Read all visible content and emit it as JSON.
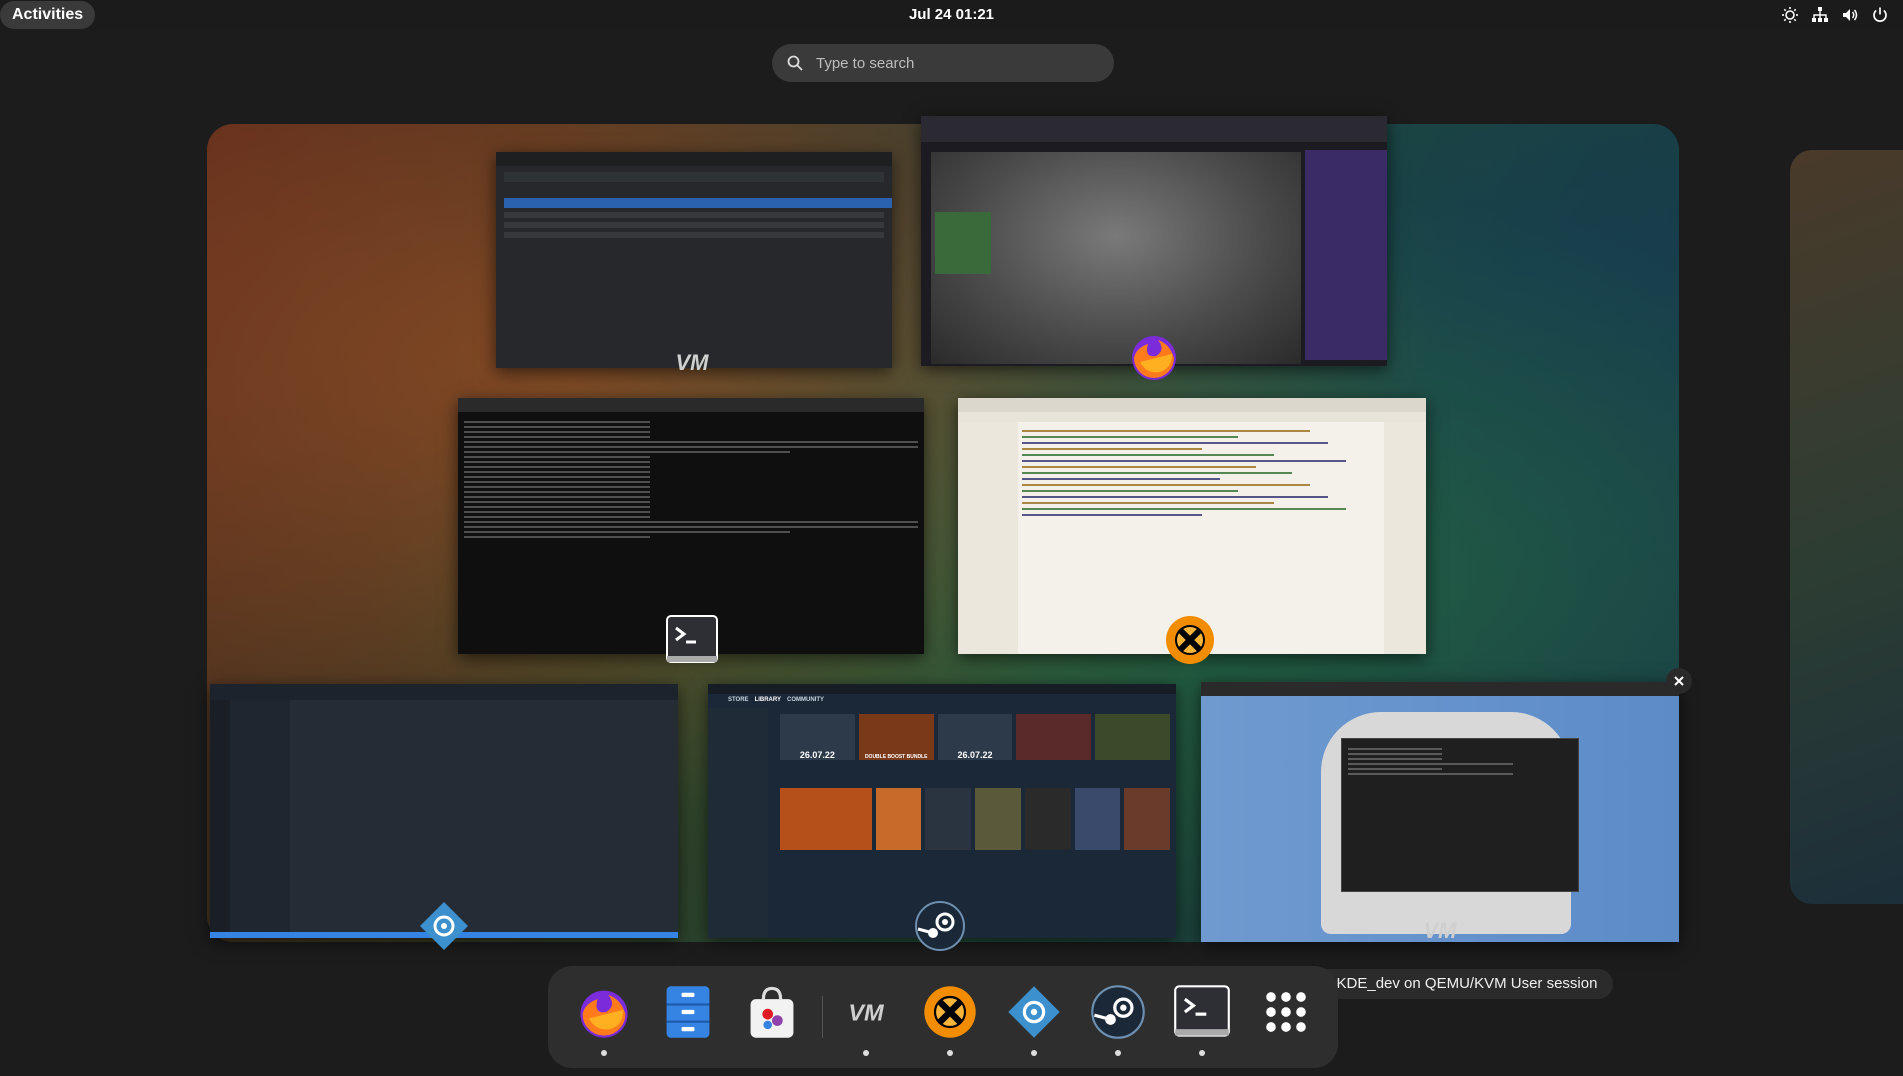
{
  "topbar": {
    "activities_label": "Activities",
    "clock": "Jul 24  01:21",
    "tray_icons": [
      "brightness-icon",
      "network-icon",
      "volume-icon",
      "power-icon"
    ]
  },
  "search": {
    "placeholder": "Type to search"
  },
  "windows": [
    {
      "id": "virt-manager-window",
      "app": "Virtual Machine Manager",
      "icon": "virt-manager-icon"
    },
    {
      "id": "firefox-window",
      "app": "Firefox",
      "icon": "firefox-icon"
    },
    {
      "id": "terminal-window",
      "app": "Terminal",
      "icon": "terminal-icon"
    },
    {
      "id": "editor-window",
      "app": "Text Editor",
      "icon": "editor-icon"
    },
    {
      "id": "kube-window",
      "app": "Kubernetes Desktop",
      "icon": "kube-icon"
    },
    {
      "id": "steam-window",
      "app": "Steam",
      "icon": "steam-icon",
      "nav": [
        "STORE",
        "LIBRARY",
        "COMMUNITY"
      ],
      "banner_dates": [
        "26.07.22",
        "26.07.22"
      ],
      "banner_text": "DOUBLE BOOST BUNDLE"
    },
    {
      "id": "vm-window",
      "app": "QEMU/KVM",
      "icon": "virt-manager-icon"
    }
  ],
  "dock": {
    "items": [
      {
        "name": "firefox",
        "running": true
      },
      {
        "name": "files",
        "running": false
      },
      {
        "name": "software",
        "running": false
      },
      {
        "name": "virt-manager",
        "running": true
      },
      {
        "name": "xfce-app",
        "running": true
      },
      {
        "name": "kube",
        "running": true
      },
      {
        "name": "steam",
        "running": true
      },
      {
        "name": "terminal",
        "running": true
      },
      {
        "name": "app-grid",
        "running": false
      }
    ]
  },
  "tooltip": {
    "text": "MOS_KDE_dev on QEMU/KVM User session"
  },
  "colors": {
    "accent_blue": "#3584e4",
    "orange": "#f28c00",
    "panel": "#1b1b1b"
  }
}
